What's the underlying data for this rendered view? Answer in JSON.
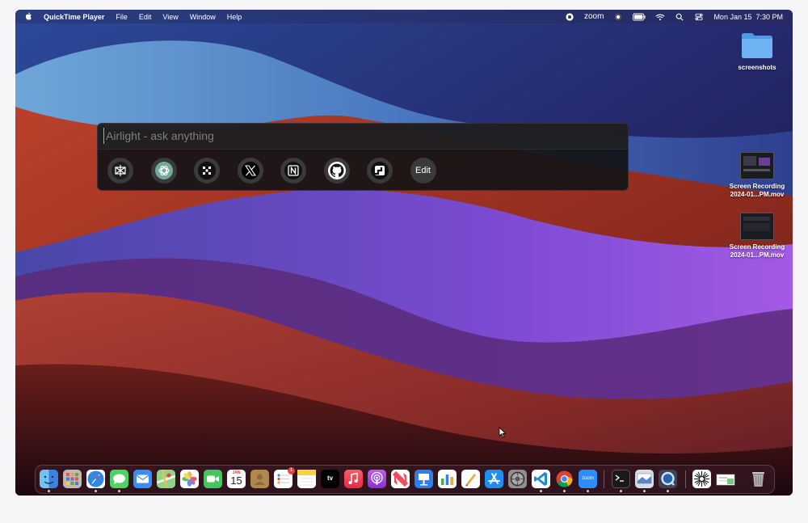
{
  "menubar": {
    "app_name": "QuickTime Player",
    "menus": [
      "File",
      "Edit",
      "View",
      "Window",
      "Help"
    ],
    "zoom_label": "zoom",
    "clock": "Mon Jan 15  7:30 PM"
  },
  "desktop": {
    "folder_label": "screenshots",
    "files": [
      {
        "line1": "Screen Recording",
        "line2": "2024-01...PM.mov"
      },
      {
        "line1": "Screen Recording",
        "line2": "2024-01...PM.mov"
      }
    ]
  },
  "airlight": {
    "placeholder": "Airlight - ask anything",
    "value": "",
    "shortcuts": [
      "perplexity-icon",
      "chatgpt-icon",
      "grok-icon",
      "x-icon",
      "notion-icon",
      "github-icon",
      "linear-icon"
    ],
    "edit_label": "Edit"
  },
  "dock": {
    "apps": [
      "finder",
      "launchpad",
      "safari",
      "messages",
      "mail",
      "maps",
      "photos",
      "facetime",
      "calendar",
      "contacts",
      "reminders",
      "notes",
      "tv",
      "music",
      "podcasts",
      "news",
      "keynote",
      "numbers",
      "pages",
      "app-store",
      "system-settings",
      "vscode",
      "chrome",
      "zoom",
      "terminal",
      "preview",
      "quicktime",
      "airlight",
      "downloads",
      "trash"
    ],
    "calendar": {
      "month": "JAN",
      "day": "15"
    },
    "reminders_badge": "1",
    "tv_label": "tv",
    "zoom_label": "zoom"
  }
}
